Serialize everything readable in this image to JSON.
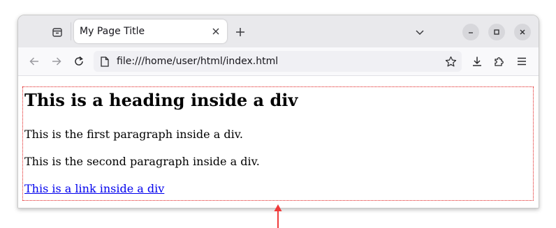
{
  "browser": {
    "tab": {
      "title": "My Page Title"
    },
    "url": "file:///home/user/html/index.html"
  },
  "page": {
    "heading": "This is a heading inside a div",
    "paragraph1": "This is the first paragraph inside a div.",
    "paragraph2": "This is the second paragraph inside a div.",
    "link": "This is a link inside a div"
  },
  "icons": {
    "tab_overview": "tab-overview-icon",
    "tab_close": "close-icon",
    "new_tab": "plus-icon",
    "list_tabs": "chevron-down-icon",
    "minimize": "minimize-icon",
    "maximize": "maximize-icon",
    "close_window": "close-icon",
    "back": "back-arrow-icon",
    "forward": "forward-arrow-icon",
    "reload": "reload-icon",
    "page": "page-icon",
    "bookmark": "star-icon",
    "downloads": "download-icon",
    "extensions": "puzzle-icon",
    "menu": "hamburger-menu-icon"
  },
  "colors": {
    "div_border": "#e01b1b",
    "link": "#0000ee",
    "annotation_arrow": "#f03a3a"
  }
}
